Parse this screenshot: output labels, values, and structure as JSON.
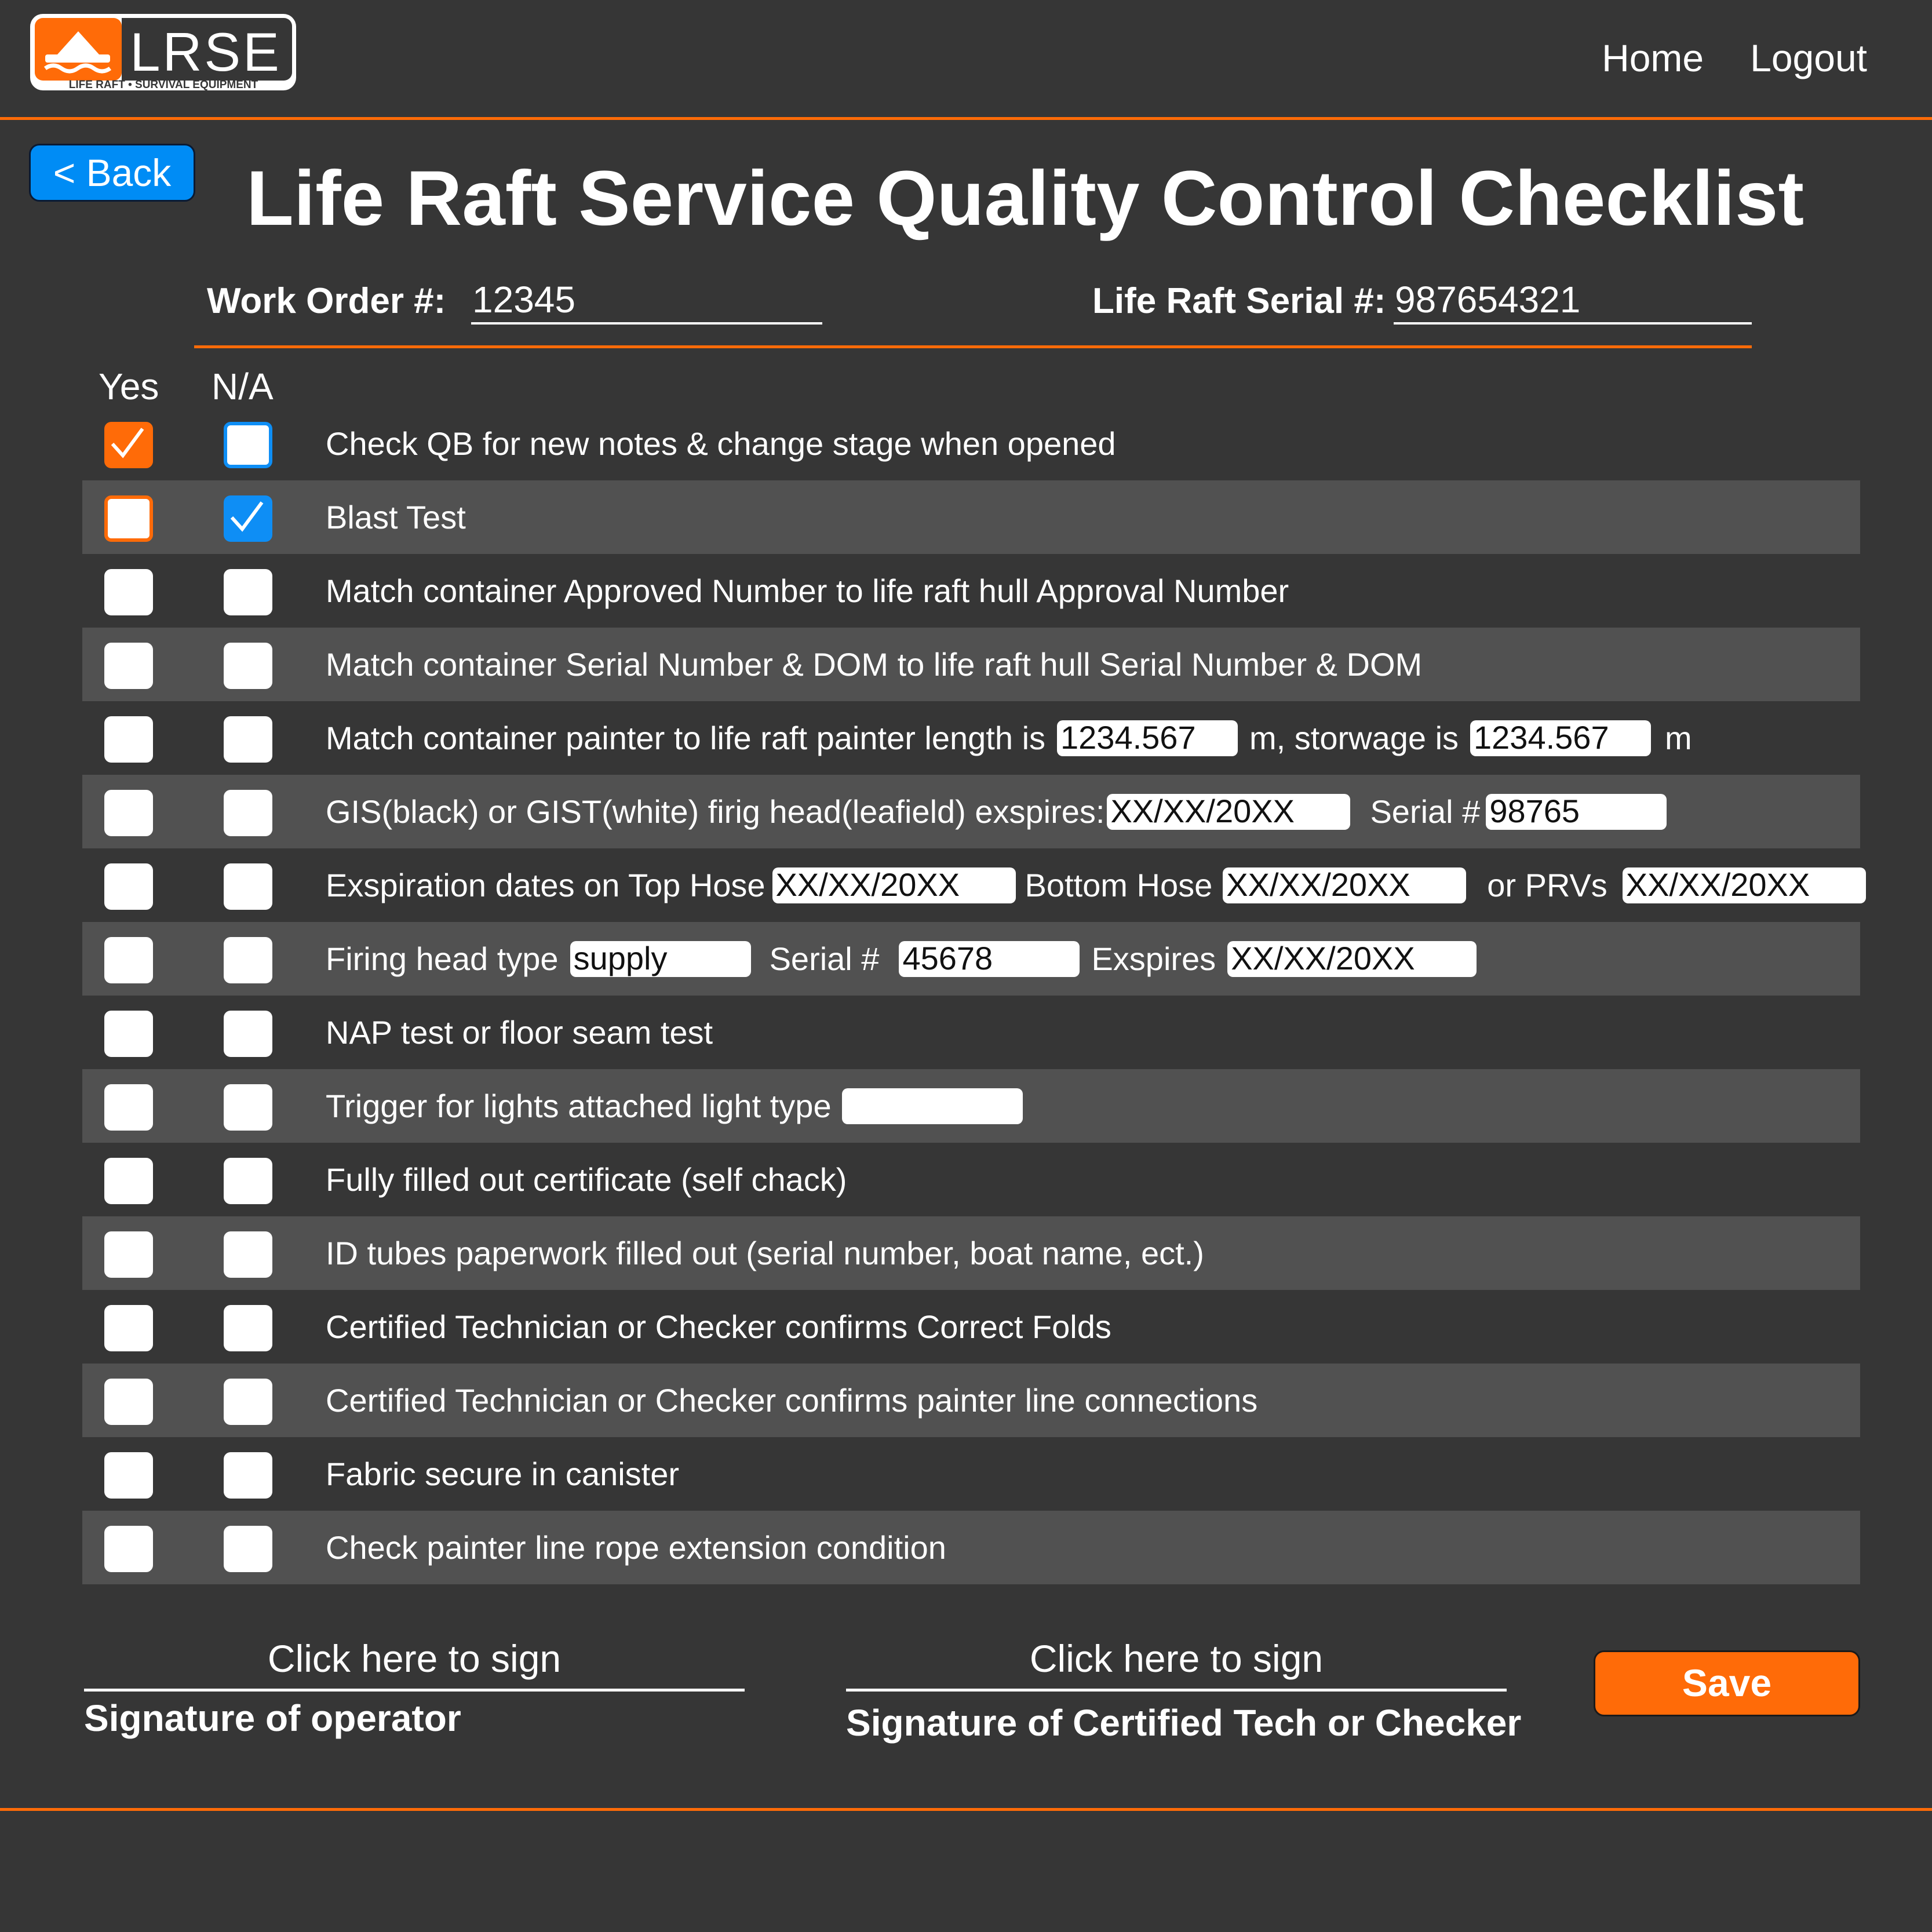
{
  "brand": {
    "logo_text": "LRSE",
    "tagline": "LIFE RAFT • SURVIVAL EQUIPMENT",
    "logo_icon": "life-raft-icon",
    "accent_color": "#ff6b08",
    "blue_color": "#0e8ef5",
    "background_color": "#363636"
  },
  "nav": {
    "home": "Home",
    "logout": "Logout"
  },
  "back_label": "< Back",
  "title": "Life Raft Service Quality Control Checklist",
  "work_order": {
    "label": "Work Order #:",
    "value": "12345"
  },
  "serial": {
    "label": "Life Raft Serial #:",
    "value": "987654321"
  },
  "columns": {
    "yes": "Yes",
    "na": "N/A"
  },
  "items": [
    {
      "text": "Check QB for new notes & change stage when opened",
      "yes_checked": true,
      "na_checked": false
    },
    {
      "text": "Blast Test",
      "yes_checked": false,
      "na_checked": true
    },
    {
      "text": "Match container Approved Number to life raft hull Approval Number",
      "yes_checked": false,
      "na_checked": false
    },
    {
      "text": "Match container Serial Number & DOM to life raft hull Serial Number & DOM",
      "yes_checked": false,
      "na_checked": false
    },
    {
      "text_a": "Match container painter to life raft painter length is",
      "field_a": "1234.567",
      "text_b": "m, storwage is",
      "field_b": "1234.567",
      "text_c": "m"
    },
    {
      "text_a": "GIS(black) or GIST(white) firig head(leafield) exspires:",
      "field_a": "XX/XX/20XX",
      "text_b": "Serial #",
      "field_b": "98765"
    },
    {
      "text_a": "Exspiration dates on Top Hose",
      "field_a": "XX/XX/20XX",
      "text_b": "Bottom Hose",
      "field_b": "XX/XX/20XX",
      "text_c": "or PRVs",
      "field_c": "XX/XX/20XX"
    },
    {
      "text_a": "Firing head type",
      "field_a": "supply",
      "text_b": "Serial #",
      "field_b": "45678",
      "text_c": "Exspires",
      "field_c": "XX/XX/20XX"
    },
    {
      "text": "NAP test or floor seam test"
    },
    {
      "text_a": "Trigger for lights attached light type",
      "field_a": ""
    },
    {
      "text": "Fully filled out certificate (self chack)"
    },
    {
      "text": "ID tubes paperwork filled out (serial number, boat name, ect.)"
    },
    {
      "text": "Certified Technician or Checker confirms Correct Folds"
    },
    {
      "text": "Certified Technician or Checker confirms painter line connections"
    },
    {
      "text": "Fabric secure in canister"
    },
    {
      "text": "Check painter line rope extension condition"
    }
  ],
  "signatures": {
    "click_prompt": "Click here to sign",
    "operator_label": "Signature of operator",
    "checker_label": "Signature of Certified Tech or Checker"
  },
  "save_label": "Save"
}
